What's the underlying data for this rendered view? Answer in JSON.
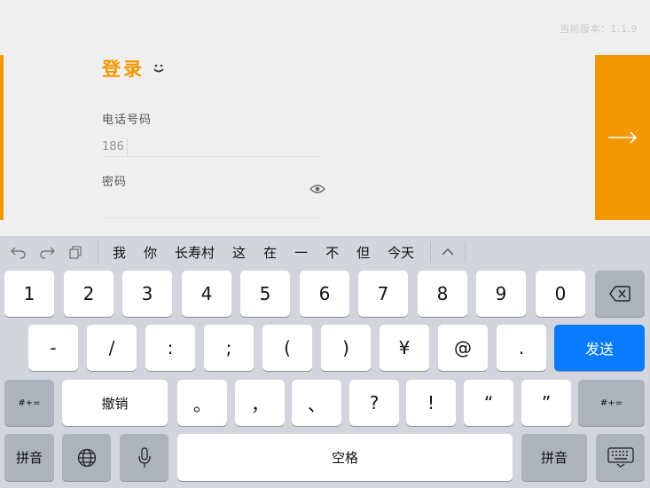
{
  "version_text": "当前版本：1.1.9",
  "login": {
    "title": "登录",
    "phone_label": "电话号码",
    "phone_value": "186",
    "password_label": "密码"
  },
  "keyboard": {
    "candidates": [
      "我",
      "你",
      "长寿村",
      "这",
      "在",
      "一",
      "不",
      "但",
      "今天"
    ],
    "row1": [
      "1",
      "2",
      "3",
      "4",
      "5",
      "6",
      "7",
      "8",
      "9",
      "0"
    ],
    "row2": [
      "-",
      "/",
      ":",
      ";",
      "(",
      ")",
      "¥",
      "@",
      "."
    ],
    "send_label": "发送",
    "row3_left": "#+=",
    "undo_label": "撤销",
    "row3": [
      "。",
      "，",
      "、",
      "?",
      "!",
      "“",
      "”"
    ],
    "row3_right": "#+=",
    "pinyin_label": "拼音",
    "space_label": "空格",
    "pinyin_right_label": "拼音"
  },
  "colors": {
    "accent": "#f39800",
    "send": "#0a7aff"
  }
}
